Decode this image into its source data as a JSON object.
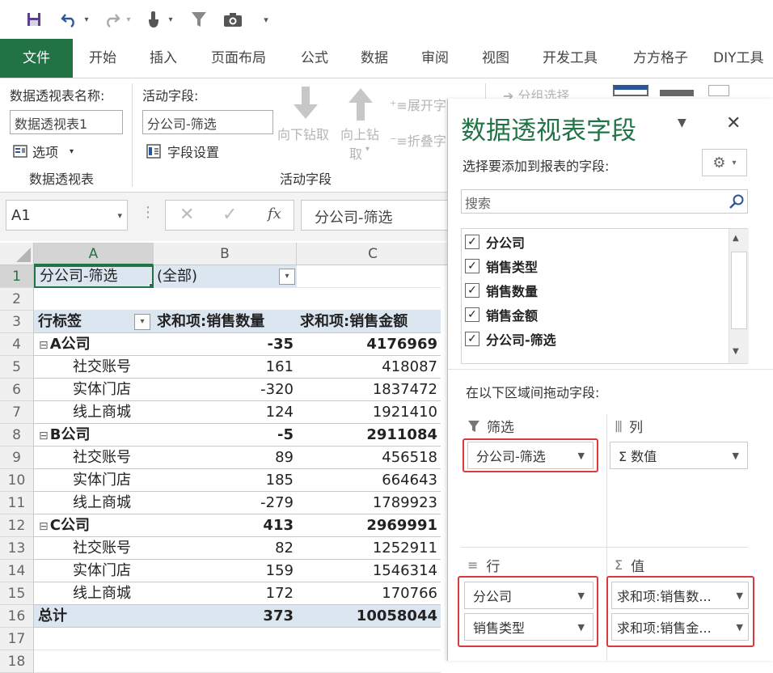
{
  "tabs": [
    "文件",
    "开始",
    "插入",
    "页面布局",
    "公式",
    "数据",
    "审阅",
    "视图",
    "开发工具",
    "方方格子",
    "DIY工具"
  ],
  "ribbon": {
    "pt_name_label": "数据透视表名称:",
    "pt_name_value": "数据透视表1",
    "options_label": "选项",
    "group1_label": "数据透视表",
    "active_field_label": "活动字段:",
    "active_field_value": "分公司-筛选",
    "field_settings_label": "字段设置",
    "drill_down_label": "向下钻取",
    "drill_up_label": "向上钻",
    "drill_up_label2": "取",
    "expand_label": "展开字",
    "collapse_label": "折叠字",
    "group_select_label": "分组选择",
    "group2_label": "活动字段"
  },
  "formula_bar": {
    "name_box": "A1",
    "fx": "fx",
    "value": "分公司-筛选"
  },
  "grid": {
    "columns": [
      "A",
      "B",
      "C"
    ],
    "rows": [
      {
        "n": "1",
        "a": "分公司-筛选",
        "b": "(全部)",
        "c": "",
        "type": "filter"
      },
      {
        "n": "2",
        "a": "",
        "b": "",
        "c": "",
        "type": "blank"
      },
      {
        "n": "3",
        "a": "行标签",
        "b": "求和项:销售数量",
        "c": "求和项:销售金额",
        "type": "header"
      },
      {
        "n": "4",
        "a": "A公司",
        "b": "-35",
        "c": "4176969",
        "type": "group"
      },
      {
        "n": "5",
        "a": "社交账号",
        "b": "161",
        "c": "418087",
        "type": "item"
      },
      {
        "n": "6",
        "a": "实体门店",
        "b": "-320",
        "c": "1837472",
        "type": "item"
      },
      {
        "n": "7",
        "a": "线上商城",
        "b": "124",
        "c": "1921410",
        "type": "item"
      },
      {
        "n": "8",
        "a": "B公司",
        "b": "-5",
        "c": "2911084",
        "type": "group"
      },
      {
        "n": "9",
        "a": "社交账号",
        "b": "89",
        "c": "456518",
        "type": "item"
      },
      {
        "n": "10",
        "a": "实体门店",
        "b": "185",
        "c": "664643",
        "type": "item"
      },
      {
        "n": "11",
        "a": "线上商城",
        "b": "-279",
        "c": "1789923",
        "type": "item"
      },
      {
        "n": "12",
        "a": "C公司",
        "b": "413",
        "c": "2969991",
        "type": "group"
      },
      {
        "n": "13",
        "a": "社交账号",
        "b": "82",
        "c": "1252911",
        "type": "item"
      },
      {
        "n": "14",
        "a": "实体门店",
        "b": "159",
        "c": "1546314",
        "type": "item"
      },
      {
        "n": "15",
        "a": "线上商城",
        "b": "172",
        "c": "170766",
        "type": "item"
      },
      {
        "n": "16",
        "a": "总计",
        "b": "373",
        "c": "10058044",
        "type": "total"
      },
      {
        "n": "17",
        "a": "",
        "b": "",
        "c": "",
        "type": "blank"
      },
      {
        "n": "18",
        "a": "",
        "b": "",
        "c": "",
        "type": "blank"
      }
    ]
  },
  "pane": {
    "title": "数据透视表字段",
    "subtitle": "选择要添加到报表的字段:",
    "search_placeholder": "搜索",
    "fields": [
      "分公司",
      "销售类型",
      "销售数量",
      "销售金额",
      "分公司-筛选"
    ],
    "drag_label": "在以下区域间拖动字段:",
    "filter_label": "筛选",
    "columns_label": "列",
    "rows_label": "行",
    "values_label": "值",
    "filter_items": [
      "分公司-筛选"
    ],
    "column_items": [
      "Σ 数值"
    ],
    "row_items": [
      "分公司",
      "销售类型"
    ],
    "value_items": [
      "求和项:销售数...",
      "求和项:销售金..."
    ]
  },
  "colors": {
    "excel_green": "#217346",
    "pivot_header_bg": "#dce6f1",
    "highlight_red": "#d83b3b"
  }
}
